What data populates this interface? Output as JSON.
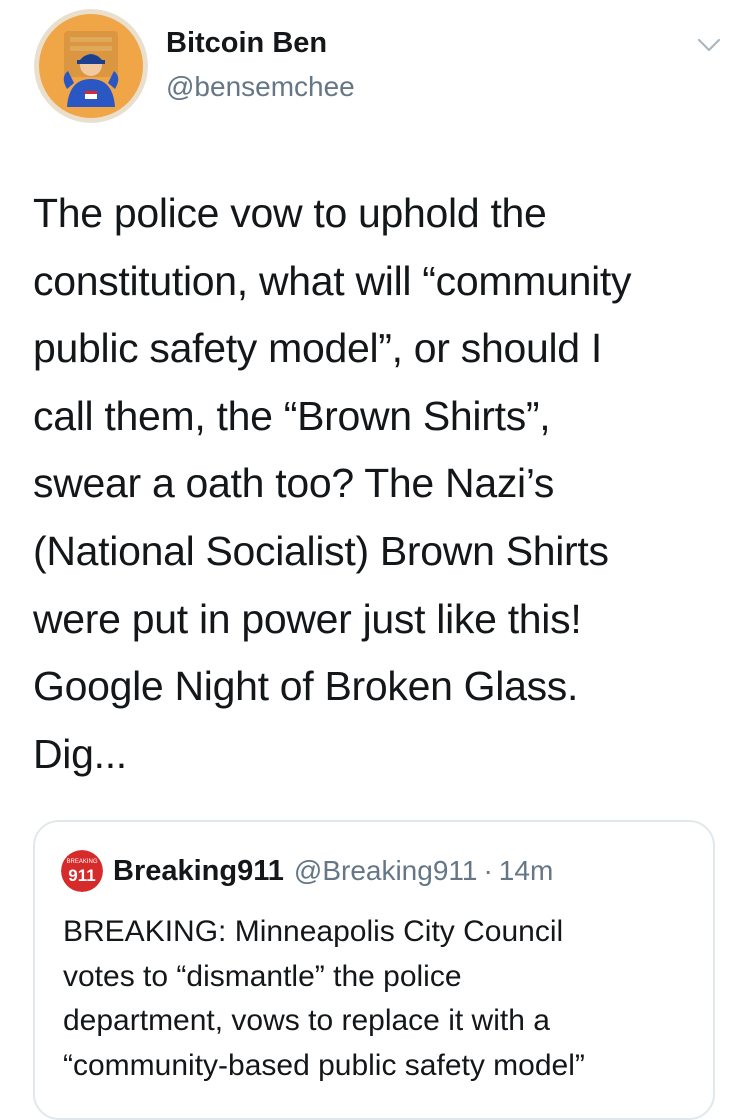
{
  "tweet": {
    "display_name": "Bitcoin Ben",
    "handle": "@bensemchee",
    "text": "The police vow to uphold the\nconstitution, what will “community\npublic safety model”, or should I\ncall them, the “Brown Shirts”,\nswear a oath too? The Nazi’s\n(National Socialist) Brown Shirts\nwere put in power just like this!\nGoogle Night of Broken Glass.\nDig...",
    "menu_icon": "chevron-down-icon"
  },
  "quote": {
    "avatar_text_top": "BREAKING",
    "avatar_text_main": "911",
    "name": "Breaking911",
    "handle": "@Breaking911",
    "separator": "·",
    "time": "14m",
    "text": "BREAKING: Minneapolis City Council\nvotes to “dismantle” the police\ndepartment, vows to replace it with a\n“community-based public safety model”"
  },
  "colors": {
    "text_primary": "#14171a",
    "text_secondary": "#657786",
    "border": "#e1e8ed",
    "avatar_bg": "#f0a547",
    "breaking_red": "#d52b2b"
  }
}
